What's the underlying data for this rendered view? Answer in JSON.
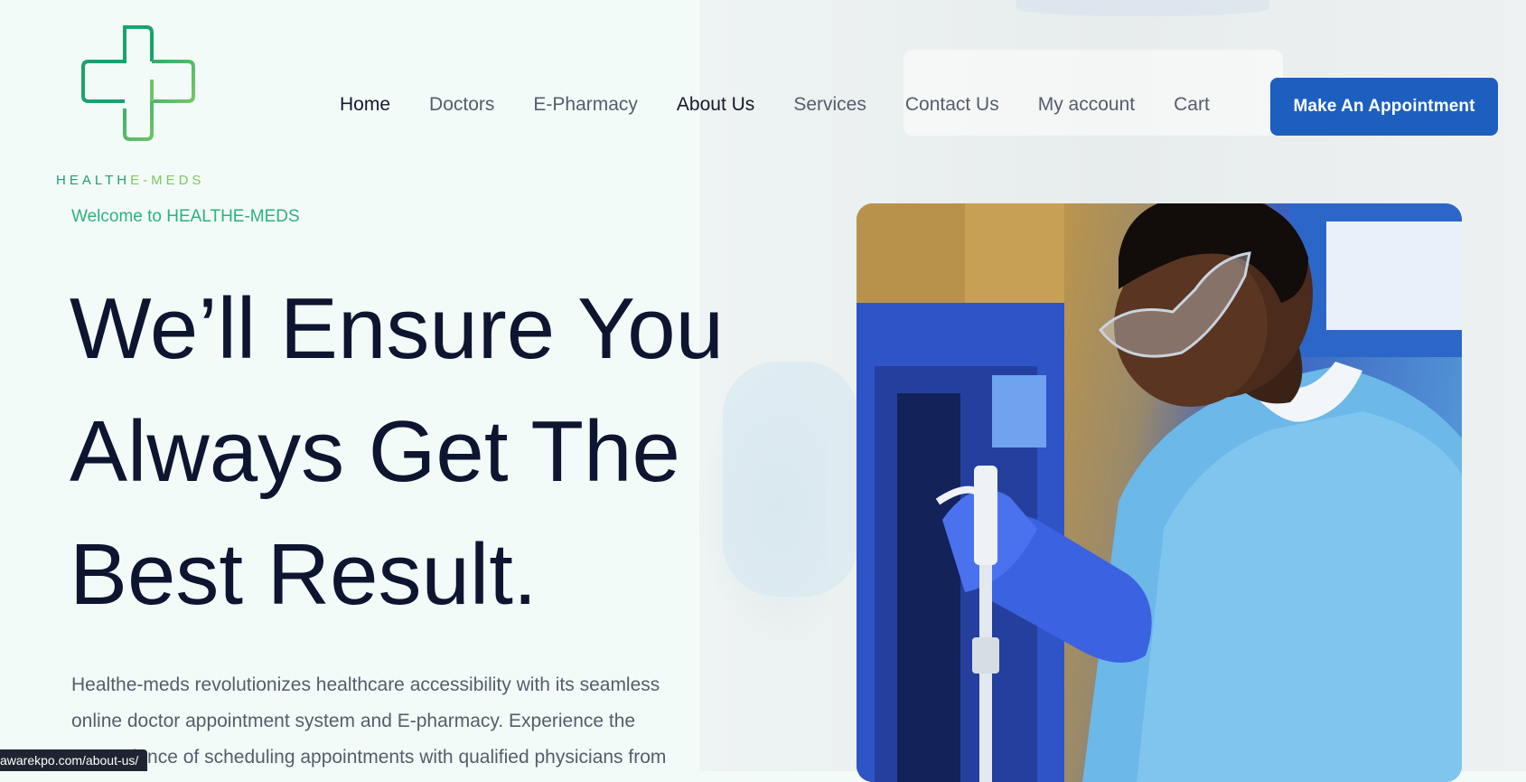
{
  "brand": {
    "name_part1": "HEALTH",
    "name_part2": "E-MEDS",
    "welcome": "Welcome to HEALTHE-MEDS"
  },
  "nav": {
    "items": [
      {
        "label": "Home"
      },
      {
        "label": "Doctors"
      },
      {
        "label": "E-Pharmacy"
      },
      {
        "label": "About Us"
      },
      {
        "label": "Services"
      },
      {
        "label": "Contact Us"
      },
      {
        "label": "My account"
      },
      {
        "label": "Cart"
      }
    ],
    "cta": "Make An Appointment"
  },
  "hero": {
    "title_lines": [
      "We’ll Ensure You",
      "Always Get The",
      "Best Result."
    ],
    "description_lines": [
      "Healthe-meds revolutionizes healthcare accessibility with its seamless",
      "online doctor appointment system and E-pharmacy. Experience the",
      "convenience of scheduling appointments with qualified physicians from"
    ]
  },
  "status_bar": {
    "url": "awarekpo.com/about-us/"
  },
  "colors": {
    "primary_button": "#1d5fbf",
    "heading": "#0d1530",
    "brand_green": "#22a06b",
    "brand_light_green": "#7dc95e"
  },
  "icons": {
    "logo": "medical-cross-icon"
  }
}
